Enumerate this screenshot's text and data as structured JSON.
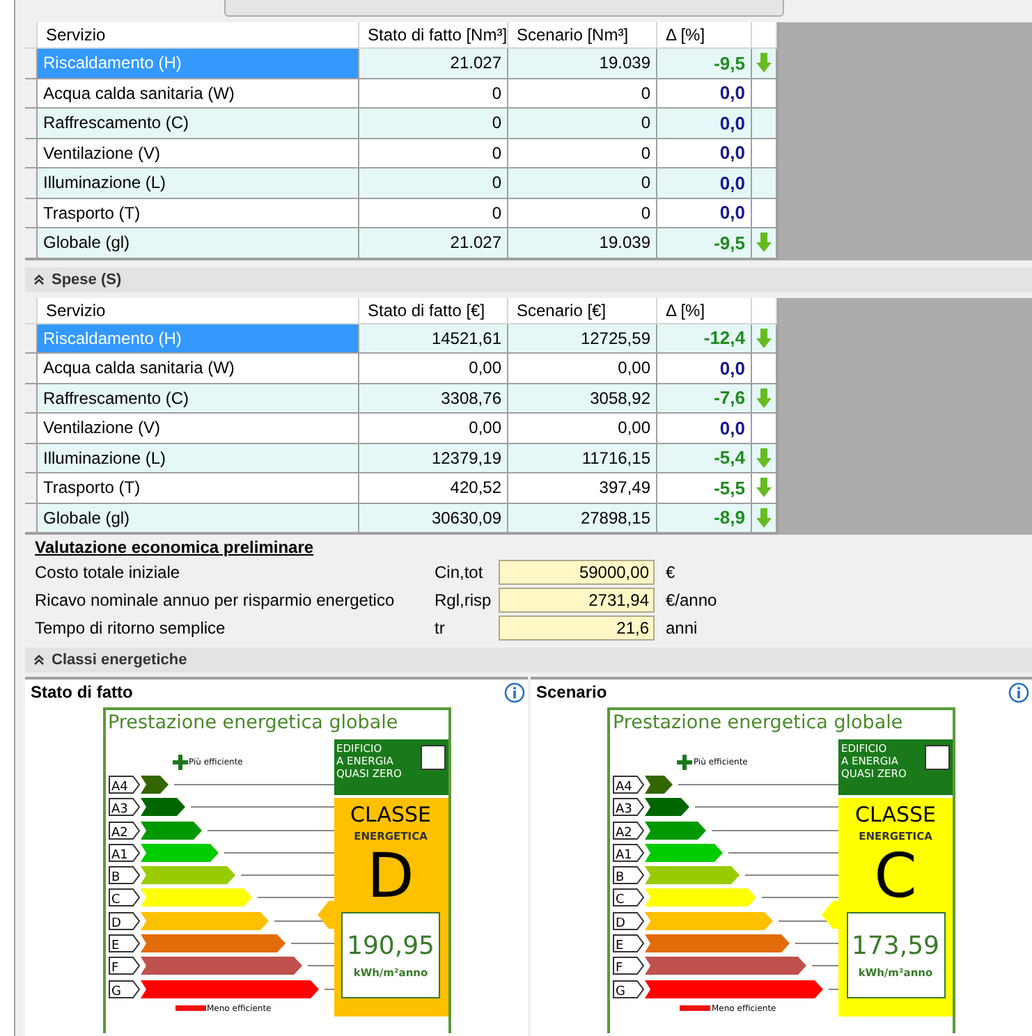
{
  "consumption_table": {
    "columns": [
      "Servizio",
      "Stato di fatto [Nm³]",
      "Scenario [Nm³]",
      "Δ [%]"
    ],
    "rows": [
      {
        "service": "Riscaldamento (H)",
        "current": "21.027",
        "scenario": "19.039",
        "delta": "-9,5",
        "decreased": true,
        "selected": true
      },
      {
        "service": "Acqua calda sanitaria (W)",
        "current": "0",
        "scenario": "0",
        "delta": "0,0",
        "decreased": false,
        "selected": false
      },
      {
        "service": "Raffrescamento (C)",
        "current": "0",
        "scenario": "0",
        "delta": "0,0",
        "decreased": false,
        "selected": false
      },
      {
        "service": "Ventilazione (V)",
        "current": "0",
        "scenario": "0",
        "delta": "0,0",
        "decreased": false,
        "selected": false
      },
      {
        "service": "Illuminazione (L)",
        "current": "0",
        "scenario": "0",
        "delta": "0,0",
        "decreased": false,
        "selected": false
      },
      {
        "service": "Trasporto (T)",
        "current": "0",
        "scenario": "0",
        "delta": "0,0",
        "decreased": false,
        "selected": false
      },
      {
        "service": "Globale (gl)",
        "current": "21.027",
        "scenario": "19.039",
        "delta": "-9,5",
        "decreased": true,
        "selected": false
      }
    ]
  },
  "costs": {
    "title": "Spese (S)",
    "expanded": true,
    "table": {
      "columns": [
        "Servizio",
        "Stato di fatto [€]",
        "Scenario [€]",
        "Δ [%]"
      ],
      "rows": [
        {
          "service": "Riscaldamento (H)",
          "current": "14521,61",
          "scenario": "12725,59",
          "delta": "-12,4",
          "decreased": true,
          "selected": true
        },
        {
          "service": "Acqua calda sanitaria (W)",
          "current": "0,00",
          "scenario": "0,00",
          "delta": "0,0",
          "decreased": false,
          "selected": false
        },
        {
          "service": "Raffrescamento (C)",
          "current": "3308,76",
          "scenario": "3058,92",
          "delta": "-7,6",
          "decreased": true,
          "selected": false
        },
        {
          "service": "Ventilazione (V)",
          "current": "0,00",
          "scenario": "0,00",
          "delta": "0,0",
          "decreased": false,
          "selected": false
        },
        {
          "service": "Illuminazione (L)",
          "current": "12379,19",
          "scenario": "11716,15",
          "delta": "-5,4",
          "decreased": true,
          "selected": false
        },
        {
          "service": "Trasporto (T)",
          "current": "420,52",
          "scenario": "397,49",
          "delta": "-5,5",
          "decreased": true,
          "selected": false
        },
        {
          "service": "Globale (gl)",
          "current": "30630,09",
          "scenario": "27898,15",
          "delta": "-8,9",
          "decreased": true,
          "selected": false
        }
      ]
    }
  },
  "economic_evaluation": {
    "title": "Valutazione economica preliminare",
    "rows": [
      {
        "label": "Costo totale iniziale",
        "symbol": "Cin,tot",
        "value": "59000,00",
        "unit": "€"
      },
      {
        "label": "Ricavo nominale annuo per risparmio energetico",
        "symbol": "Rgl,risp",
        "value": "2731,94",
        "unit": "€/anno"
      },
      {
        "label": "Tempo di ritorno semplice",
        "symbol": "tr",
        "value": "21,6",
        "unit": "anni"
      }
    ]
  },
  "energy_classes": {
    "title": "Classi energetiche",
    "expanded": true,
    "panels": [
      {
        "title": "Stato di fatto",
        "label": {
          "heading": "Prestazione energetica globale",
          "more_efficient": "Più efficiente",
          "less_efficient": "Meno efficiente",
          "nzeb": "EDIFICIO\nA ENERGIA\nQUASI ZERO",
          "nzeb_checked": false,
          "class_title": "CLASSE",
          "class_subtitle": "ENERGETICA",
          "class": "D",
          "color": "#ffc000",
          "value": "190,95",
          "unit": "kWh/m²anno",
          "classes": [
            {
              "name": "A4",
              "color": "#336600"
            },
            {
              "name": "A3",
              "color": "#006600"
            },
            {
              "name": "A2",
              "color": "#009900"
            },
            {
              "name": "A1",
              "color": "#00cc00"
            },
            {
              "name": "B",
              "color": "#99cc00"
            },
            {
              "name": "C",
              "color": "#ffff00"
            },
            {
              "name": "D",
              "color": "#ffc000"
            },
            {
              "name": "E",
              "color": "#e36c0a"
            },
            {
              "name": "F",
              "color": "#c0504d"
            },
            {
              "name": "G",
              "color": "#ff0000"
            }
          ]
        }
      },
      {
        "title": "Scenario",
        "label": {
          "heading": "Prestazione energetica globale",
          "more_efficient": "Più efficiente",
          "less_efficient": "Meno efficiente",
          "nzeb": "EDIFICIO\nA ENERGIA\nQUASI ZERO",
          "nzeb_checked": false,
          "class_title": "CLASSE",
          "class_subtitle": "ENERGETICA",
          "class": "C",
          "color": "#ffff00",
          "value": "173,59",
          "unit": "kWh/m²anno",
          "classes": [
            {
              "name": "A4",
              "color": "#336600"
            },
            {
              "name": "A3",
              "color": "#006600"
            },
            {
              "name": "A2",
              "color": "#009900"
            },
            {
              "name": "A1",
              "color": "#00cc00"
            },
            {
              "name": "B",
              "color": "#99cc00"
            },
            {
              "name": "C",
              "color": "#ffff00"
            },
            {
              "name": "D",
              "color": "#ffc000"
            },
            {
              "name": "E",
              "color": "#e36c0a"
            },
            {
              "name": "F",
              "color": "#c0504d"
            },
            {
              "name": "G",
              "color": "#ff0000"
            }
          ]
        }
      }
    ]
  }
}
